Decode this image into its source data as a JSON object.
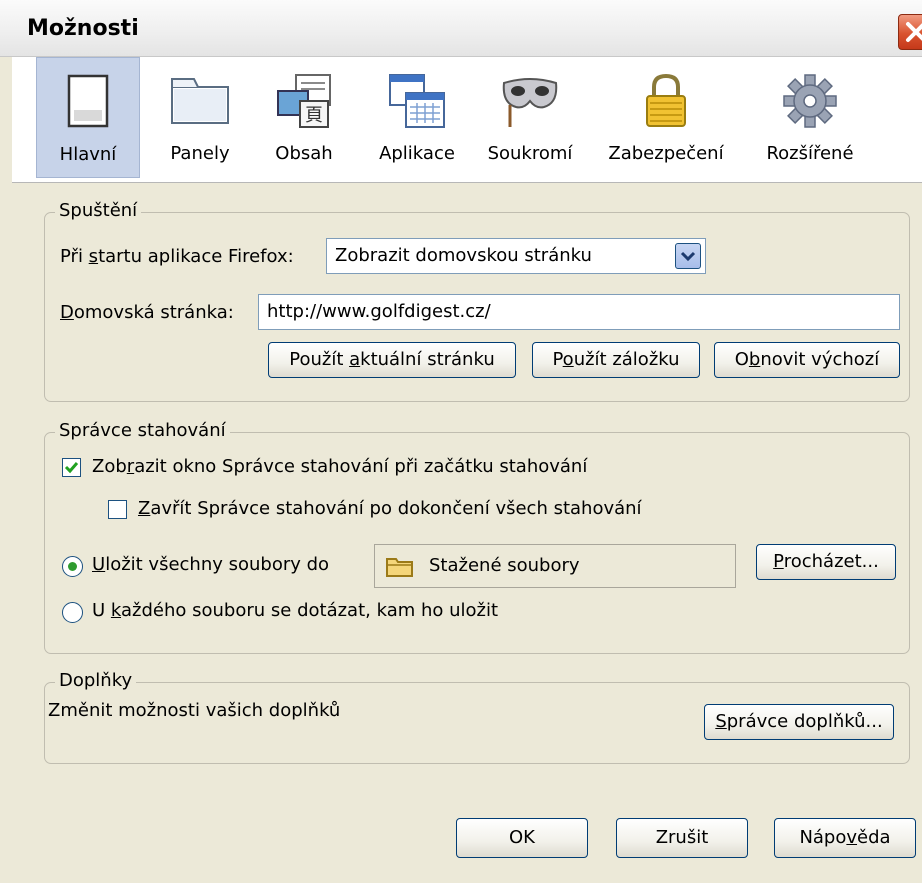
{
  "window": {
    "title": "Možnosti"
  },
  "tabs": [
    {
      "label": "Hlavní",
      "icon": "general-window-icon",
      "selected": true
    },
    {
      "label": "Panely",
      "icon": "tabs-folder-icon"
    },
    {
      "label": "Obsah",
      "icon": "content-icon"
    },
    {
      "label": "Aplikace",
      "icon": "applications-icon"
    },
    {
      "label": "Soukromí",
      "icon": "privacy-mask-icon"
    },
    {
      "label": "Zabezpečení",
      "icon": "security-lock-icon"
    },
    {
      "label": "Rozšířené",
      "icon": "advanced-gear-icon"
    }
  ],
  "startup": {
    "legend": "Spuštění",
    "when_label_pre": "Při ",
    "when_label_ul": "s",
    "when_label_post": "tartu aplikace Firefox:",
    "when_value": "Zobrazit domovskou stránku",
    "home_label_ul": "D",
    "home_label_post": "omovská stránka:",
    "home_value": "http://www.golfdigest.cz/",
    "btn_current_pre": "Použít ",
    "btn_current_ul": "a",
    "btn_current_post": "ktuální stránku",
    "btn_bookmark_pre": "P",
    "btn_bookmark_ul": "o",
    "btn_bookmark_post": "užít záložku",
    "btn_restore_pre": "O",
    "btn_restore_ul": "b",
    "btn_restore_post": "novit výchozí"
  },
  "downloads": {
    "legend": "Správce stahování",
    "show_pre": "Zob",
    "show_ul": "r",
    "show_post": "azit okno Správce stahování při začátku stahování",
    "show_checked": true,
    "close_ul": "Z",
    "close_post": "avřít Správce stahování po dokončení všech stahování",
    "close_checked": false,
    "save_ul": "U",
    "save_post": "ložit všechny soubory do",
    "save_selected": true,
    "folder_name": "Stažené soubory",
    "browse_ul": "P",
    "browse_post": "rocházet...",
    "ask_pre": "U ",
    "ask_ul": "k",
    "ask_post": "aždého souboru se dotázat, kam ho uložit"
  },
  "addons": {
    "legend": "Doplňky",
    "description": "Změnit možnosti vašich doplňků",
    "manage_ul": "S",
    "manage_post": "právce doplňků..."
  },
  "footer": {
    "ok": "OK",
    "cancel": "Zrušit",
    "help_pre": "Nápo",
    "help_ul": "v",
    "help_post": "ěda"
  },
  "colors": {
    "selected_tab": "#c7d3e9",
    "dialog_bg": "#ece9d8",
    "close_red": "#d9532f"
  }
}
